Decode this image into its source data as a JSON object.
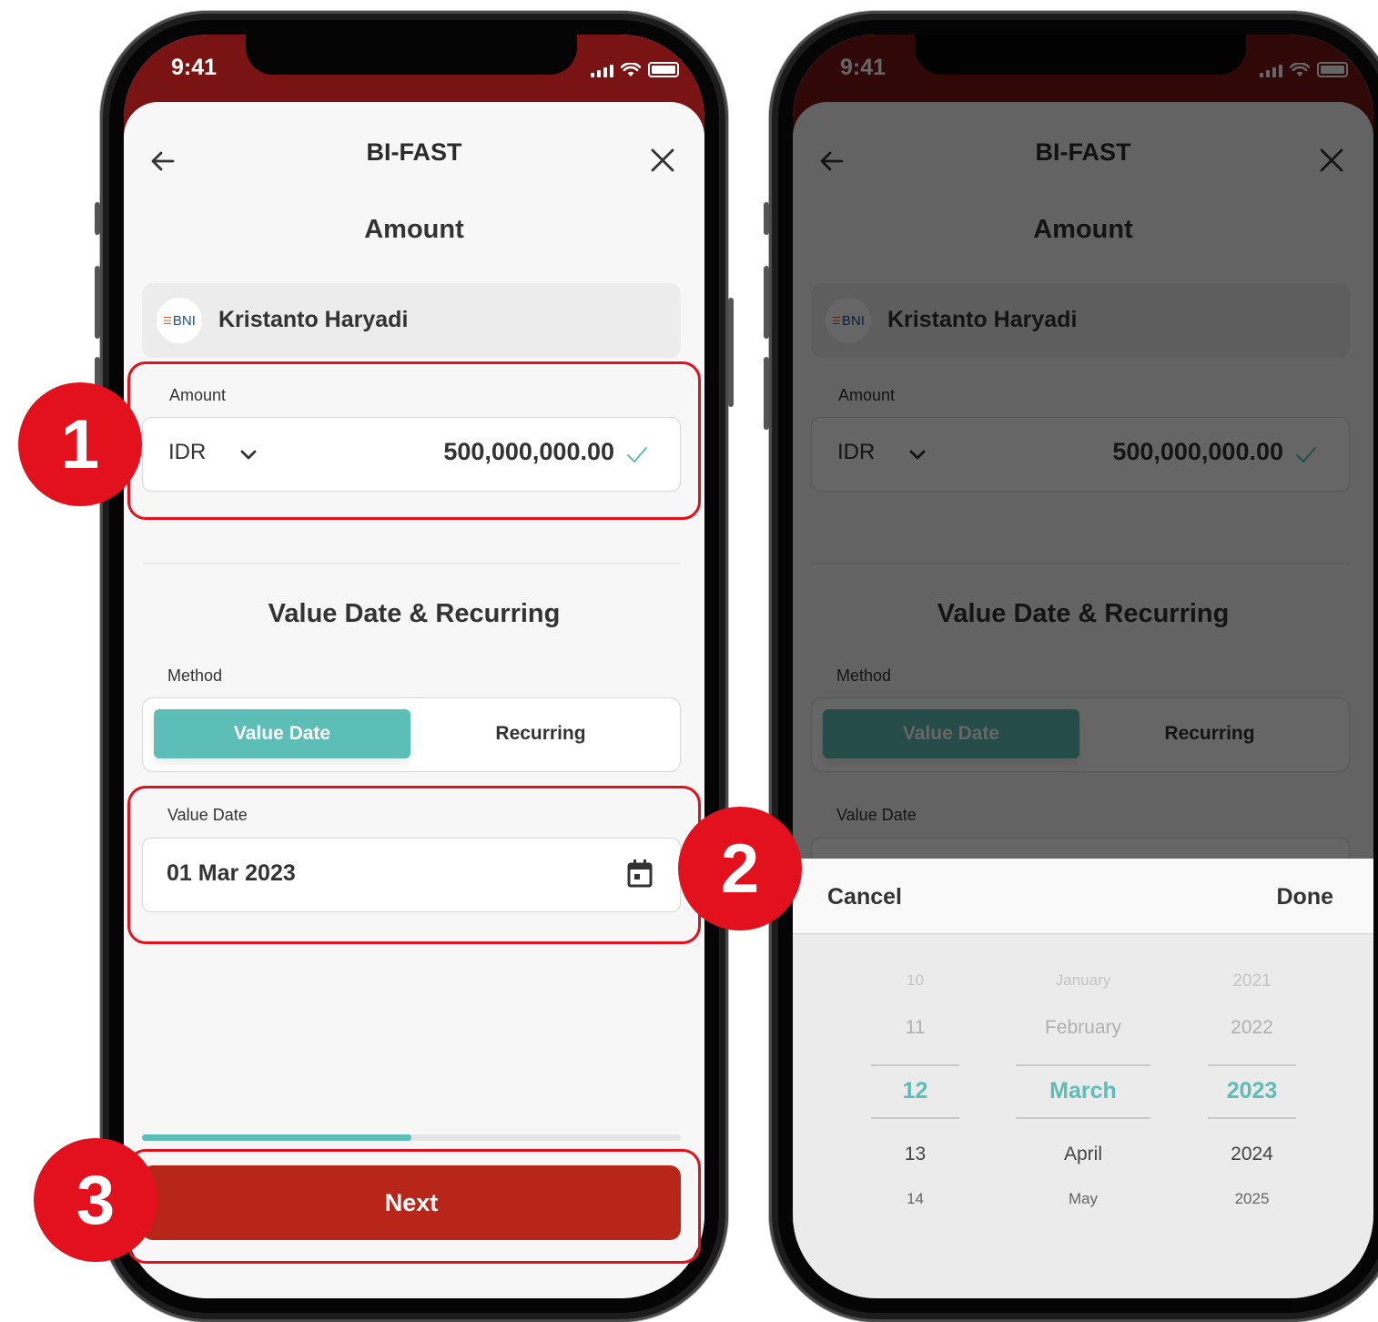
{
  "status_bar": {
    "time": "9:41"
  },
  "header": {
    "title": "BI-FAST"
  },
  "amount_section": {
    "title": "Amount",
    "recipient": {
      "bank": "BNI",
      "name": "Kristanto Haryadi"
    },
    "field_label": "Amount",
    "currency": "IDR",
    "value": "500,000,000.00"
  },
  "value_date_section": {
    "title": "Value Date & Recurring",
    "method_label": "Method",
    "methods": [
      "Value Date",
      "Recurring"
    ],
    "selected_method": "Value Date",
    "date_label": "Value Date",
    "date_value": "01 Mar 2023"
  },
  "progress": {
    "fraction": 0.5
  },
  "next_label": "Next",
  "date_picker": {
    "cancel_label": "Cancel",
    "done_label": "Done",
    "days": [
      "10",
      "11",
      "12",
      "13",
      "14"
    ],
    "months": [
      "January",
      "February",
      "March",
      "April",
      "May"
    ],
    "years": [
      "2021",
      "2022",
      "2023",
      "2024",
      "2025"
    ],
    "selected_day": "12",
    "selected_month": "March",
    "selected_year": "2023"
  },
  "callouts": [
    "1",
    "2",
    "3"
  ],
  "colors": {
    "brand_red": "#b8261a",
    "header_maroon": "#7a1414",
    "teal": "#5dbdb7",
    "callout_red": "#e3111d"
  },
  "icons": [
    "back-arrow-icon",
    "close-icon",
    "chevron-down-icon",
    "check-icon",
    "calendar-icon",
    "signal-icon",
    "wifi-icon",
    "battery-icon"
  ]
}
